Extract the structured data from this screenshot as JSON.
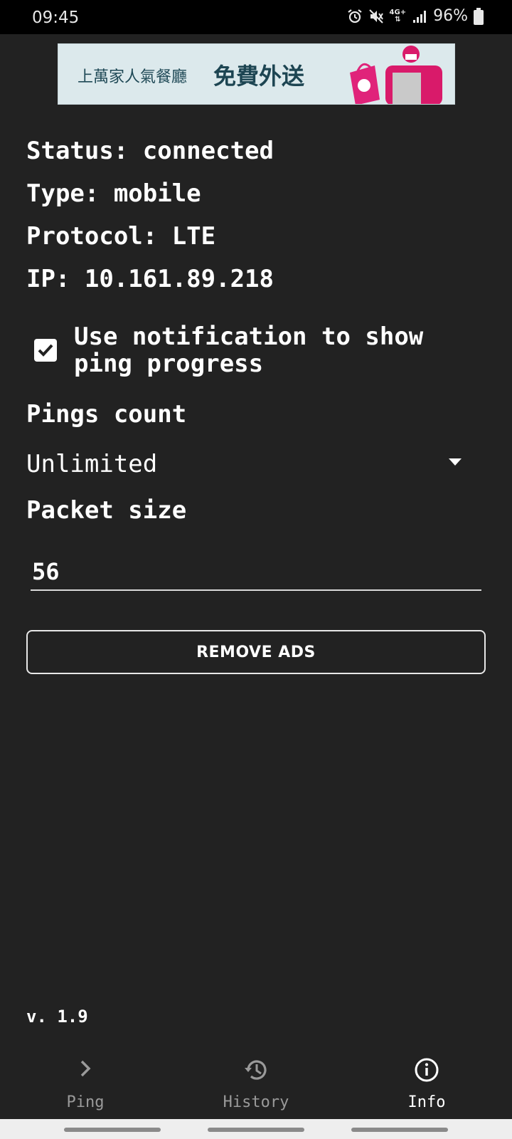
{
  "status_bar": {
    "time": "09:45",
    "network_label": "4G+",
    "battery": "96%",
    "icons": [
      "alarm-icon",
      "mute-icon",
      "network-4g-icon",
      "signal-icon",
      "battery-icon"
    ]
  },
  "ad": {
    "text_small": "上萬家人氣餐廳",
    "text_big": "免費外送"
  },
  "info": {
    "status": "Status: connected",
    "type": "Type: mobile",
    "protocol": "Protocol: LTE",
    "ip": "IP: 10.161.89.218"
  },
  "notification_checkbox": {
    "checked": true,
    "label": "Use notification to show ping progress"
  },
  "pings_count": {
    "label": "Pings count",
    "value": "Unlimited"
  },
  "packet_size": {
    "label": "Packet size",
    "value": "56"
  },
  "remove_ads_button": "REMOVE ADS",
  "version": "v. 1.9",
  "nav": {
    "items": [
      {
        "label": "Ping",
        "icon": "chevron-right-icon",
        "active": false
      },
      {
        "label": "History",
        "icon": "history-icon",
        "active": false
      },
      {
        "label": "Info",
        "icon": "info-icon",
        "active": true
      }
    ]
  },
  "colors": {
    "background": "#222222",
    "text": "#ffffff",
    "inactive": "#9a9a9a"
  }
}
